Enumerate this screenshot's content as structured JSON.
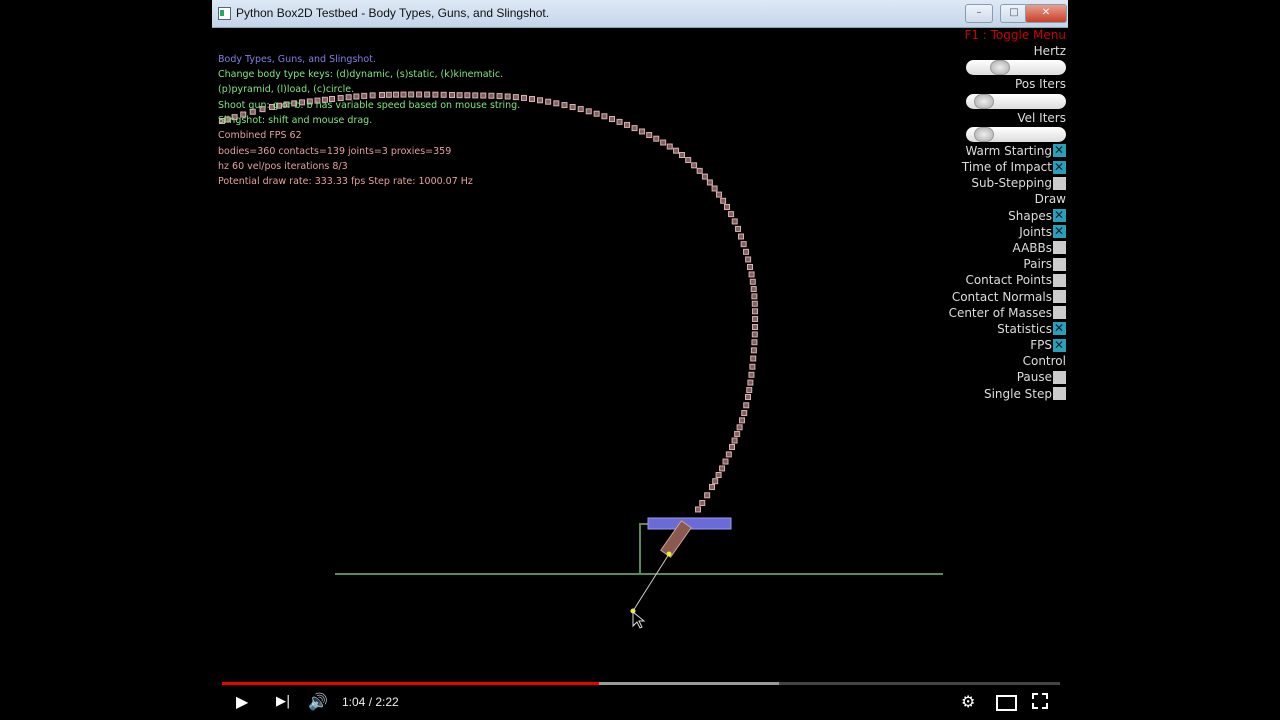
{
  "window": {
    "title": "Python Box2D Testbed - Body Types, Guns, and Slingshot.",
    "minimize": "–",
    "maximize": "□",
    "close": "✕"
  },
  "info": {
    "title": "Body Types, Guns, and Slingshot.",
    "lines": [
      "Change body type keys: (d)dynamic, (s)static, (k)kinematic.",
      "(p)pyramid, (l)load, (c)circle.",
      "Shoot gun: g or b. b has variable speed based on mouse string.",
      "Slingshot: shift and mouse drag."
    ],
    "stats": [
      "Combined FPS 62",
      "bodies=360 contacts=139 joints=3 proxies=359",
      "hz 60 vel/pos iterations 8/3",
      "Potential draw rate: 333.33 fps Step rate: 1000.07 Hz"
    ],
    "colors": {
      "title": "#7f7fe6",
      "lines": "#7fe67f",
      "stats": "#e6a0a0"
    }
  },
  "menu": {
    "toggle": "F1 : Toggle Menu",
    "sliders": [
      {
        "label": "Hertz",
        "value": 0.3
      },
      {
        "label": "Pos Iters",
        "value": 0.1
      },
      {
        "label": "Vel Iters",
        "value": 0.1
      }
    ],
    "items": [
      {
        "label": "Warm Starting",
        "checked": true
      },
      {
        "label": "Time of Impact",
        "checked": true
      },
      {
        "label": "Sub-Stepping",
        "checked": false
      },
      {
        "label": "Draw",
        "header": true
      },
      {
        "label": "Shapes",
        "checked": true
      },
      {
        "label": "Joints",
        "checked": true
      },
      {
        "label": "AABBs",
        "checked": false
      },
      {
        "label": "Pairs",
        "checked": false
      },
      {
        "label": "Contact Points",
        "checked": false
      },
      {
        "label": "Contact Normals",
        "checked": false
      },
      {
        "label": "Center of Masses",
        "checked": false
      },
      {
        "label": "Statistics",
        "checked": true
      },
      {
        "label": "FPS",
        "checked": true
      },
      {
        "label": "Control",
        "header": true
      },
      {
        "label": "Pause",
        "checked": false
      },
      {
        "label": "Single Step",
        "checked": false
      }
    ]
  },
  "player": {
    "time": "1:04 / 2:22",
    "played": 0.45,
    "buffered": 0.665,
    "icons": [
      "play-icon",
      "next-icon",
      "volume-icon",
      "settings-icon",
      "theater-icon",
      "fullscreen-icon"
    ]
  }
}
